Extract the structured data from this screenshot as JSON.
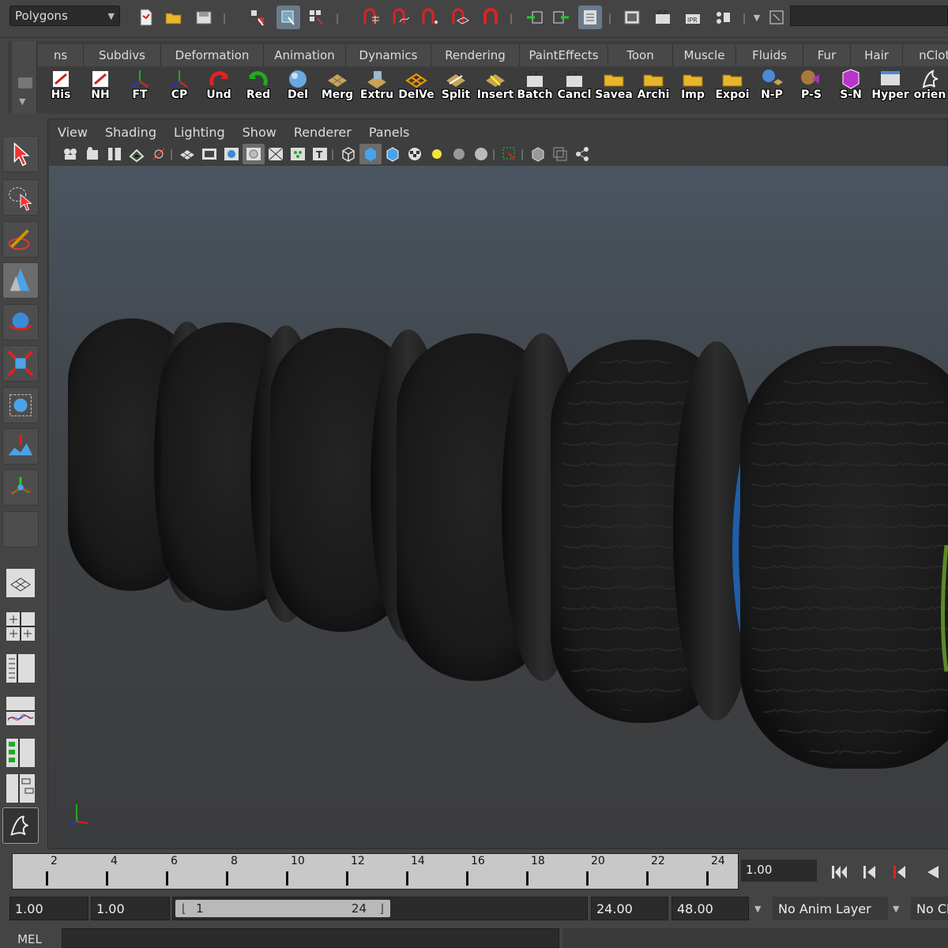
{
  "status_line": {
    "mode": "Polygons",
    "icons": [
      "new-scene",
      "open-scene",
      "save-scene",
      "select-hierarchy",
      "select-object",
      "select-component",
      "snap-grid",
      "snap-curve",
      "snap-point",
      "snap-surface",
      "snap-magnet",
      "input-ops",
      "output-ops",
      "render-view",
      "render-frame",
      "ipr-render",
      "render-settings",
      "display-render"
    ]
  },
  "shelf": {
    "tabs": [
      "ns",
      "Subdivs",
      "Deformation",
      "Animation",
      "Dynamics",
      "Rendering",
      "PaintEffects",
      "Toon",
      "Muscle",
      "Fluids",
      "Fur",
      "Hair",
      "nCloth"
    ],
    "tab_widths": [
      58,
      98,
      130,
      104,
      108,
      112,
      112,
      82,
      80,
      85,
      60,
      66,
      90
    ],
    "icons": [
      {
        "label": "His",
        "icon": "history-icon"
      },
      {
        "label": "NH",
        "icon": "nohistory-icon"
      },
      {
        "label": "FT",
        "icon": "freeze-transform-icon"
      },
      {
        "label": "CP",
        "icon": "center-pivot-icon"
      },
      {
        "label": "Und",
        "icon": "undo-icon"
      },
      {
        "label": "Red",
        "icon": "redo-icon"
      },
      {
        "label": "Del",
        "icon": "delete-history-icon"
      },
      {
        "label": "Merg",
        "icon": "merge-icon"
      },
      {
        "label": "Extru",
        "icon": "extrude-icon"
      },
      {
        "label": "DelVe",
        "icon": "delete-vertex-icon"
      },
      {
        "label": "Split",
        "icon": "split-icon"
      },
      {
        "label": "Insert",
        "icon": "insert-edge-icon"
      },
      {
        "label": "Batch",
        "icon": "batch-icon"
      },
      {
        "label": "Cancl",
        "icon": "cancel-icon"
      },
      {
        "label": "Savea",
        "icon": "save-as-icon"
      },
      {
        "label": "Archi",
        "icon": "archive-icon"
      },
      {
        "label": "Imp",
        "icon": "import-icon"
      },
      {
        "label": "Expoi",
        "icon": "export-icon"
      },
      {
        "label": "N-P",
        "icon": "nurbs-to-poly-icon"
      },
      {
        "label": "P-S",
        "icon": "poly-to-subd-icon"
      },
      {
        "label": "S-N",
        "icon": "subd-to-nurbs-icon"
      },
      {
        "label": "Hyper",
        "icon": "hypershade-icon"
      },
      {
        "label": "orien",
        "icon": "orient-icon"
      }
    ]
  },
  "panel": {
    "menus": [
      "View",
      "Shading",
      "Lighting",
      "Show",
      "Renderer",
      "Panels"
    ]
  },
  "viewport": {
    "background_top": "#4a5560",
    "background_bottom": "#3b3c3e",
    "tire_color": "#1b1b1b",
    "rim_colors": [
      "#888888",
      "#b0221a",
      "#1f5ea8",
      "#5a8a2a"
    ]
  },
  "timeline": {
    "tick_labels": [
      "2",
      "4",
      "6",
      "8",
      "10",
      "12",
      "14",
      "16",
      "18",
      "20",
      "22",
      "24"
    ],
    "current_frame": "1.00"
  },
  "range": {
    "start_time": "1.00",
    "playback_start": "1.00",
    "slider_start": "1",
    "slider_end": "24",
    "playback_end": "24.00",
    "end_time": "48.00",
    "anim_layer": "No Anim Layer",
    "character": "No Ch"
  },
  "command_line": {
    "label": "MEL"
  }
}
